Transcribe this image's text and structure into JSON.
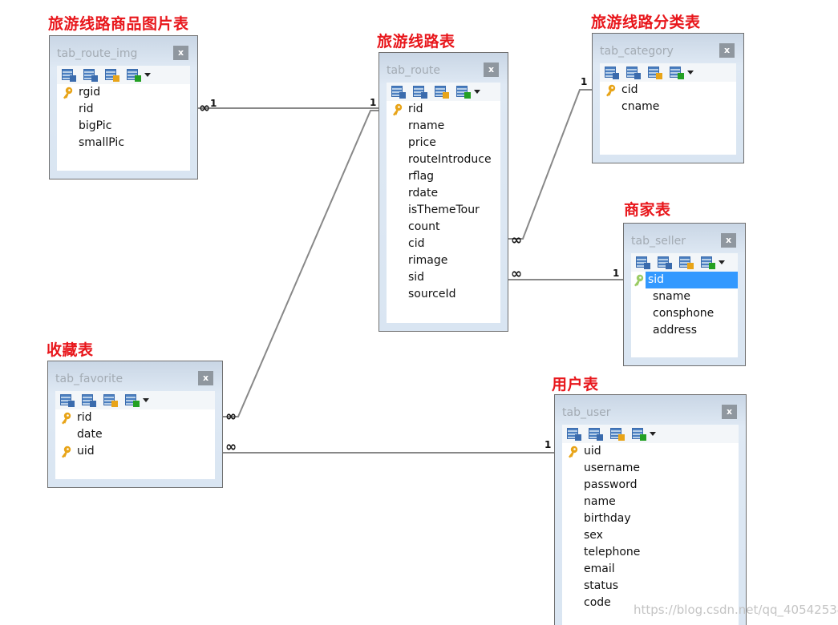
{
  "tables": [
    {
      "id": "route_img",
      "label": "旅游线路商品图片表",
      "name": "tab_route_img",
      "close": "x",
      "fields": [
        "rgid",
        "rid",
        "bigPic",
        "smallPic"
      ],
      "keys": [
        "rgid"
      ],
      "selected": null
    },
    {
      "id": "route",
      "label": "旅游线路表",
      "name": "tab_route",
      "close": "x",
      "fields": [
        "rid",
        "rname",
        "price",
        "routeIntroduce",
        "rflag",
        "rdate",
        "isThemeTour",
        "count",
        "cid",
        "rimage",
        "sid",
        "sourceId"
      ],
      "keys": [
        "rid"
      ],
      "selected": null
    },
    {
      "id": "category",
      "label": "旅游线路分类表",
      "name": "tab_category",
      "close": "x",
      "fields": [
        "cid",
        "cname"
      ],
      "keys": [
        "cid"
      ],
      "selected": null
    },
    {
      "id": "seller",
      "label": "商家表",
      "name": "tab_seller",
      "close": "x",
      "fields": [
        "sid",
        "sname",
        "consphone",
        "address"
      ],
      "keys": [
        "sid"
      ],
      "selected": "sid"
    },
    {
      "id": "favorite",
      "label": "收藏表",
      "name": "tab_favorite",
      "close": "x",
      "fields": [
        "rid",
        "date",
        "uid"
      ],
      "keys": [
        "rid",
        "uid"
      ],
      "selected": null
    },
    {
      "id": "user",
      "label": "用户表",
      "name": "tab_user",
      "close": "x",
      "fields": [
        "uid",
        "username",
        "password",
        "name",
        "birthday",
        "sex",
        "telephone",
        "email",
        "status",
        "code"
      ],
      "keys": [
        "uid"
      ],
      "selected": null
    }
  ],
  "relations": [
    {
      "from": "tab_route_img",
      "to": "tab_route",
      "many": "∞",
      "one": "1"
    },
    {
      "from": "tab_favorite",
      "to": "tab_route",
      "many": "∞",
      "one": "1"
    },
    {
      "from": "tab_favorite",
      "to": "tab_user",
      "many": "∞",
      "one": "1"
    },
    {
      "from": "tab_route",
      "to": "tab_category",
      "many": "∞",
      "one": "1"
    },
    {
      "from": "tab_route",
      "to": "tab_seller",
      "many": "∞",
      "one": "1"
    }
  ],
  "toolbar_icons": [
    "edit-table-icon",
    "table-properties-icon",
    "primary-key-icon",
    "import-icon",
    "dropdown-arrow-icon"
  ],
  "colors": {
    "label": "#e8161b",
    "selection": "#3399ff",
    "key": "#e8a418"
  },
  "watermark": "https://blog.csdn.net/qq_40542534"
}
